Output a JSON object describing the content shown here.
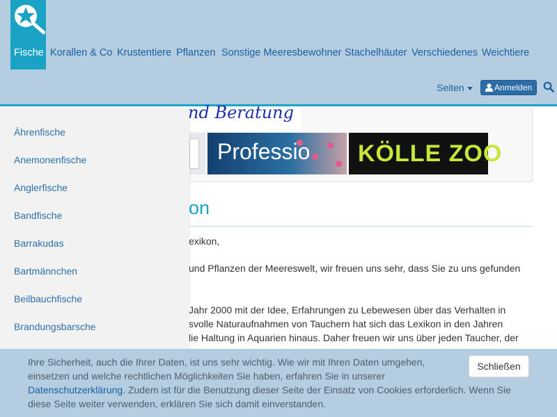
{
  "navbar": {
    "items": [
      {
        "label": "Fische",
        "active": true
      },
      {
        "label": "Korallen & Co"
      },
      {
        "label": "Krustentiere"
      },
      {
        "label": "Pflanzen"
      },
      {
        "label": "Sonstige Meeresbewohner"
      },
      {
        "label": "Stachelhäuter"
      },
      {
        "label": "Verschiedenes"
      },
      {
        "label": "Weichtiere"
      }
    ],
    "pages_label": "Seiten",
    "login_label": "Anmelden",
    "icons": {
      "logo": "starfish-magnifier-logo",
      "login": "user-icon",
      "search": "search-icon"
    },
    "colors": {
      "bar": "#b5cde0",
      "accent": "#1aa3c4",
      "link": "#1a5fa0",
      "button": "#2c6ca8"
    }
  },
  "banners": {
    "handwriting": "nd Beratung",
    "professional": "Professio",
    "koelle": "KÖLLE ZOO"
  },
  "main": {
    "heading": "on",
    "paragraphs": [
      "exikon,",
      "und Pflanzen der Meereswelt, wir freuen uns sehr, dass Sie zu uns gefunden",
      "Jahr 2000 mit der Idee, Erfahrungen zu Lebewesen über das Verhalten in",
      "svolle Naturaufnahmen von Tauchern hat sich das Lexikon in den Jahren",
      "lie Haltung in Aquarien hinaus. Daher freuen wir uns über jeden Taucher, der"
    ]
  },
  "sidebar": {
    "items": [
      "Ährenfische",
      "Anemonenfische",
      "Anglerfische",
      "Bandfische",
      "Barrakudas",
      "Bartmännchen",
      "Beilbauchfische",
      "Brandungsbarsche"
    ]
  },
  "cookie": {
    "line1": "Ihre Sicherheit, auch die Ihrer Daten, ist uns sehr wichtig. Wie wir mit Ihren Daten umgehen,",
    "line2": "einsetzen und welche rechtlichen Möglichkeiten Sie haben, erfahren Sie in unserer",
    "link": "Datenschutzerklärung",
    "line3_rest": ". Zudem ist für die Benutzung dieser Seite der Einsatz von Cookies erforderlich. Wenn Sie",
    "line4": "diese Seite weiter verwenden, erklären Sie sich damit einverstanden.",
    "close_label": "Schließen"
  }
}
